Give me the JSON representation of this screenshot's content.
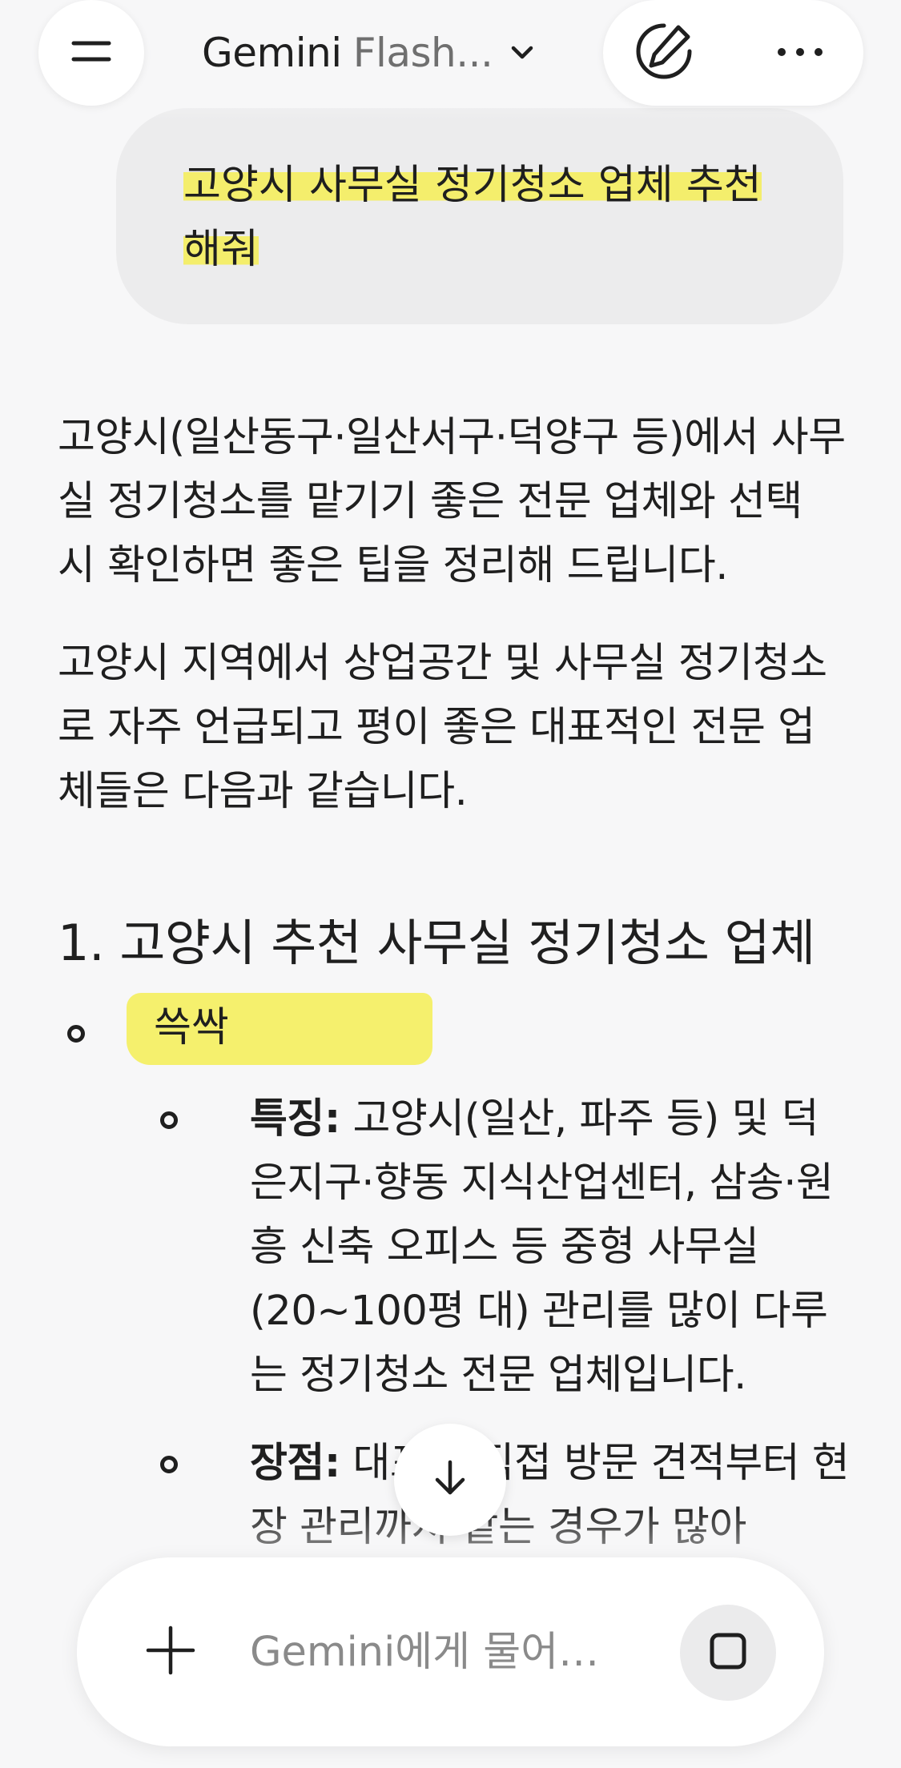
{
  "header": {
    "model_name": "Gemini",
    "model_variant": "Flash..."
  },
  "user_message": {
    "line1": "고양시 사무실 정기청소 업체 추천",
    "line2": "해줘"
  },
  "response": {
    "paragraphs": [
      "고양시(일산동구·일산서구·덕양구 등)에서 사무실 정기청소를 맡기기 좋은 전문 업체와 선택 시 확인하면 좋은 팁을 정리해 드립니다.",
      "고양시 지역에서 상업공간 및 사무실 정기청소로 자주 언급되고 평이 좋은 대표적인 전문 업체들은 다음과 같습니다."
    ],
    "section_heading": "1. 고양시 추천 사무실 정기청소 업체",
    "company": {
      "name": "쓱싹",
      "details": [
        {
          "label": "특징:",
          "text": " 고양시(일산, 파주 등) 및 덕은지구·향동 지식산업센터, 삼송·원흥 신축 오피스 등 중형 사무실(20~100평 대) 관리를 많이 다루는 정기청소 전문 업체입니다."
        },
        {
          "label": "장점:",
          "text": " 대표가 직접 방문 견적부터 현장 관리까지 맡는 경우가 많아"
        }
      ]
    }
  },
  "composer": {
    "placeholder": "Gemini에게 물어…"
  },
  "icons": {
    "menu": "menu-icon",
    "model_dropdown": "chevron-down-icon",
    "new_chat": "edit-pencil-icon",
    "more": "more-horizontal-icon",
    "scroll_down": "arrow-down-icon",
    "add": "plus-icon",
    "stop": "stop-square-icon"
  },
  "colors": {
    "highlight": "#f5ee55",
    "background": "#f7f7f8",
    "bubble": "#ececed"
  }
}
